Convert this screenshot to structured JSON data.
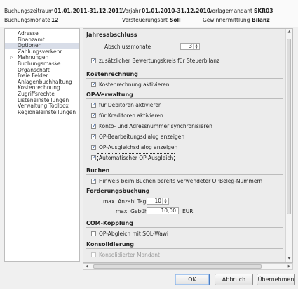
{
  "header": {
    "buchungszeitraum_label": "Buchungszeitraum",
    "buchungszeitraum_value": "01.01.2011-31.12.2011",
    "vorjahr_label": "Vorjahr",
    "vorjahr_value": "01.01.2010-31.12.2010",
    "vorlagemandant_label": "Vorlagemandant",
    "vorlagemandant_value": "SKR03",
    "buchungsmonate_label": "Buchungsmonate",
    "buchungsmonate_value": "12",
    "versteuerungsart_label": "Versteuerungsart",
    "versteuerungsart_value": "Soll",
    "gewinnermittlung_label": "Gewinnermittlung",
    "gewinnermittlung_value": "Bilanz"
  },
  "sidebar": {
    "items": [
      {
        "label": "Adresse"
      },
      {
        "label": "Finanzamt"
      },
      {
        "label": "Optionen",
        "selected": true
      },
      {
        "label": "Zahlungsverkehr"
      },
      {
        "label": "Mahnungen",
        "expandable": true
      },
      {
        "label": "Buchungsmaske"
      },
      {
        "label": "Organschaft"
      },
      {
        "label": "Freie Felder"
      },
      {
        "label": "Anlagenbuchhaltung"
      },
      {
        "label": "Kostenrechnung"
      },
      {
        "label": "Zugriffsrechte"
      },
      {
        "label": "Listeneinstellungen"
      },
      {
        "label": "Verwaltung Toolbox"
      },
      {
        "label": "Regionaleinstellungen"
      }
    ]
  },
  "sections": {
    "jahresabschluss": {
      "title": "Jahresabschluss",
      "abschlussmonate_label": "Abschlussmonate",
      "abschlussmonate_value": "3",
      "bewertungskreis_label": "zusätzlicher Bewertungskreis für Steuerbilanz",
      "bewertungskreis_checked": true
    },
    "kostenrechnung": {
      "title": "Kostenrechnung",
      "aktivieren_label": "Kostenrechnung aktivieren",
      "aktivieren_checked": true
    },
    "op_verwaltung": {
      "title": "OP-Verwaltung",
      "options": [
        {
          "label": "für Debitoren aktivieren",
          "checked": true
        },
        {
          "label": "für Kreditoren aktivieren",
          "checked": true
        },
        {
          "label": "Konto- und Adressnummer synchronisieren",
          "checked": true
        },
        {
          "label": "OP-Bearbeitungsdialog anzeigen",
          "checked": true
        },
        {
          "label": "OP-Ausgleichsdialog anzeigen",
          "checked": true
        },
        {
          "label": "Automatischer OP-Ausgleich",
          "checked": true
        }
      ]
    },
    "buchen": {
      "title": "Buchen",
      "hinweis_label": "Hinweis beim Buchen bereits verwendeter OPBeleg-Nummern",
      "hinweis_checked": true
    },
    "forderungsbuchung": {
      "title": "Forderungsbuchung",
      "tage_label": "max. Anzahl Tage",
      "tage_value": "10",
      "gebuehr_label": "max. Gebühr",
      "gebuehr_value": "10,00",
      "gebuehr_unit": "EUR"
    },
    "com_kopplung": {
      "title": "COM-Kopplung",
      "sql_label": "OP-Abgleich mit SQL-Wawi",
      "sql_checked": false
    },
    "konsolidierung": {
      "title": "Konsolidierung",
      "mandant_label": "Konsolidierter Mandant",
      "mandant_checked": false,
      "mandant_disabled": true
    }
  },
  "buttons": {
    "ok": "OK",
    "abbruch": "Abbruch",
    "uebernehmen": "Übernehmen"
  },
  "icons": {
    "spin": "spin-arrows-icon",
    "check": "checkmark-icon",
    "expand": "tree-expand-icon"
  }
}
